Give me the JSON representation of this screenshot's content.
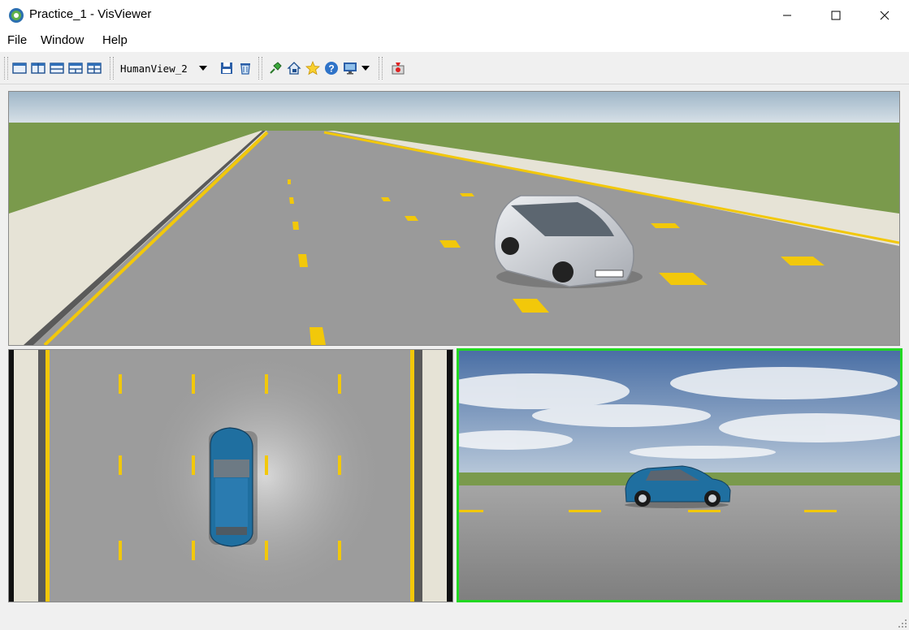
{
  "window": {
    "title": "Practice_1 - VisViewer",
    "minimize_icon": "minimize-icon",
    "maximize_icon": "maximize-icon",
    "close_icon": "close-icon"
  },
  "menu": {
    "items": [
      "File",
      "Window",
      "Help"
    ]
  },
  "toolbar": {
    "layout_buttons": [
      "layout-single-icon",
      "layout-two-columns-icon",
      "layout-two-rows-icon",
      "layout-top-bottom-split-icon",
      "layout-quad-icon"
    ],
    "view_selector": {
      "selected": "HumanView_2"
    },
    "other_icons": [
      "save-icon",
      "delete-icon",
      "pin-icon",
      "home-camera-icon",
      "star-icon",
      "help-icon",
      "monitor-icon",
      "record-icon"
    ]
  },
  "viewports": {
    "top": {
      "name": "perspective-view"
    },
    "bottom_left": {
      "name": "top-down-view"
    },
    "bottom_right": {
      "name": "side-chase-view",
      "active_border_color": "#22d822"
    }
  },
  "colors": {
    "grass": "#7a9a4c",
    "road": "#9a9a9a",
    "lane_marking": "#f2c80a",
    "sidewalk": "#e6e3d6",
    "sky": "#c8d6e0",
    "blue_car": "#1f6fa0",
    "white_car": "#d0d2d6"
  }
}
